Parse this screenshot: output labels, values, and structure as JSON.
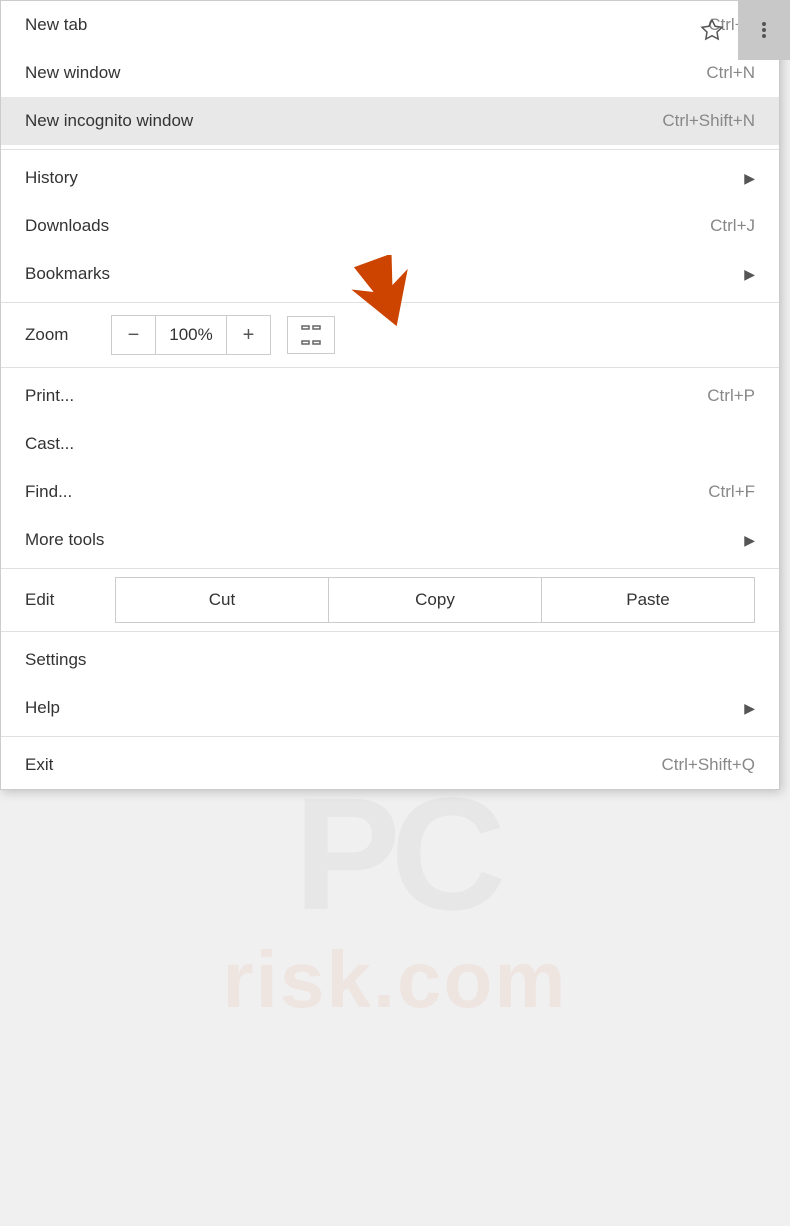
{
  "topbar": {
    "star_title": "Bookmark this tab",
    "menu_title": "Customize and control Google Chrome"
  },
  "menu": {
    "items": [
      {
        "id": "new-tab",
        "label": "New tab",
        "shortcut": "Ctrl+T",
        "has_arrow": false,
        "highlighted": false
      },
      {
        "id": "new-window",
        "label": "New window",
        "shortcut": "Ctrl+N",
        "has_arrow": false,
        "highlighted": false
      },
      {
        "id": "new-incognito-window",
        "label": "New incognito window",
        "shortcut": "Ctrl+Shift+N",
        "has_arrow": false,
        "highlighted": true
      },
      {
        "id": "history",
        "label": "History",
        "shortcut": "",
        "has_arrow": true,
        "highlighted": false
      },
      {
        "id": "downloads",
        "label": "Downloads",
        "shortcut": "Ctrl+J",
        "has_arrow": false,
        "highlighted": false
      },
      {
        "id": "bookmarks",
        "label": "Bookmarks",
        "shortcut": "",
        "has_arrow": true,
        "highlighted": false
      }
    ],
    "zoom": {
      "label": "Zoom",
      "minus": "−",
      "value": "100%",
      "plus": "+",
      "fullscreen_title": "Full screen"
    },
    "lower_items": [
      {
        "id": "print",
        "label": "Print...",
        "shortcut": "Ctrl+P",
        "has_arrow": false
      },
      {
        "id": "cast",
        "label": "Cast...",
        "shortcut": "",
        "has_arrow": false
      },
      {
        "id": "find",
        "label": "Find...",
        "shortcut": "Ctrl+F",
        "has_arrow": false
      },
      {
        "id": "more-tools",
        "label": "More tools",
        "shortcut": "",
        "has_arrow": true
      }
    ],
    "edit": {
      "label": "Edit",
      "cut": "Cut",
      "copy": "Copy",
      "paste": "Paste"
    },
    "bottom_items": [
      {
        "id": "settings",
        "label": "Settings",
        "shortcut": "",
        "has_arrow": false
      },
      {
        "id": "help",
        "label": "Help",
        "shortcut": "",
        "has_arrow": true
      },
      {
        "id": "exit",
        "label": "Exit",
        "shortcut": "Ctrl+Shift+Q",
        "has_arrow": false
      }
    ]
  }
}
